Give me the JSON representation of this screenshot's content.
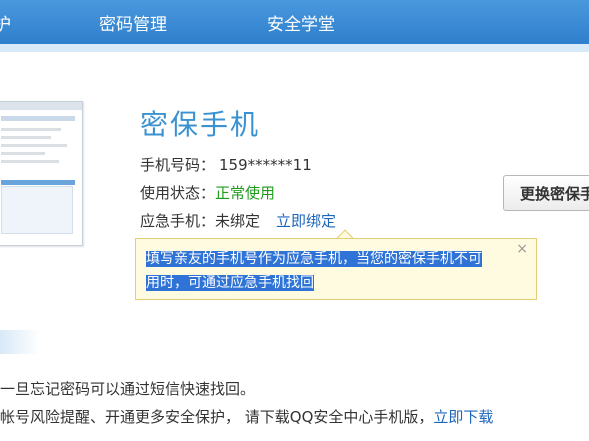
{
  "nav": {
    "items": [
      {
        "label": "护"
      },
      {
        "label": "密码管理"
      },
      {
        "label": "安全学堂"
      }
    ]
  },
  "section": {
    "title": "密保手机",
    "phone_label": "手机号码：",
    "phone_value": "159******11",
    "status_label": "使用状态：",
    "status_value": "正常使用",
    "emergency_label": "应急手机：",
    "emergency_value": "未绑定",
    "bind_link": "立即绑定",
    "change_button": "更换密保手机"
  },
  "tooltip": {
    "line1": "填写亲友的手机号作为应急手机，当您的密保手机不可",
    "line2": "用时，可通过应急手机找回",
    "close": "×"
  },
  "description": {
    "line1": "一旦忘记密码可以通过短信快速找回。",
    "line2_text": "帐号风险提醒、开通更多安全保护， 请下载QQ安全中心手机版，",
    "line2_link": "立即下载"
  },
  "colors": {
    "nav_bg": "#3a8ad6",
    "title": "#3b92d0",
    "status_ok": "#1e9c19",
    "link": "#1d66bb",
    "tooltip_bg": "#fffbe0",
    "selection": "#2f73d6"
  }
}
